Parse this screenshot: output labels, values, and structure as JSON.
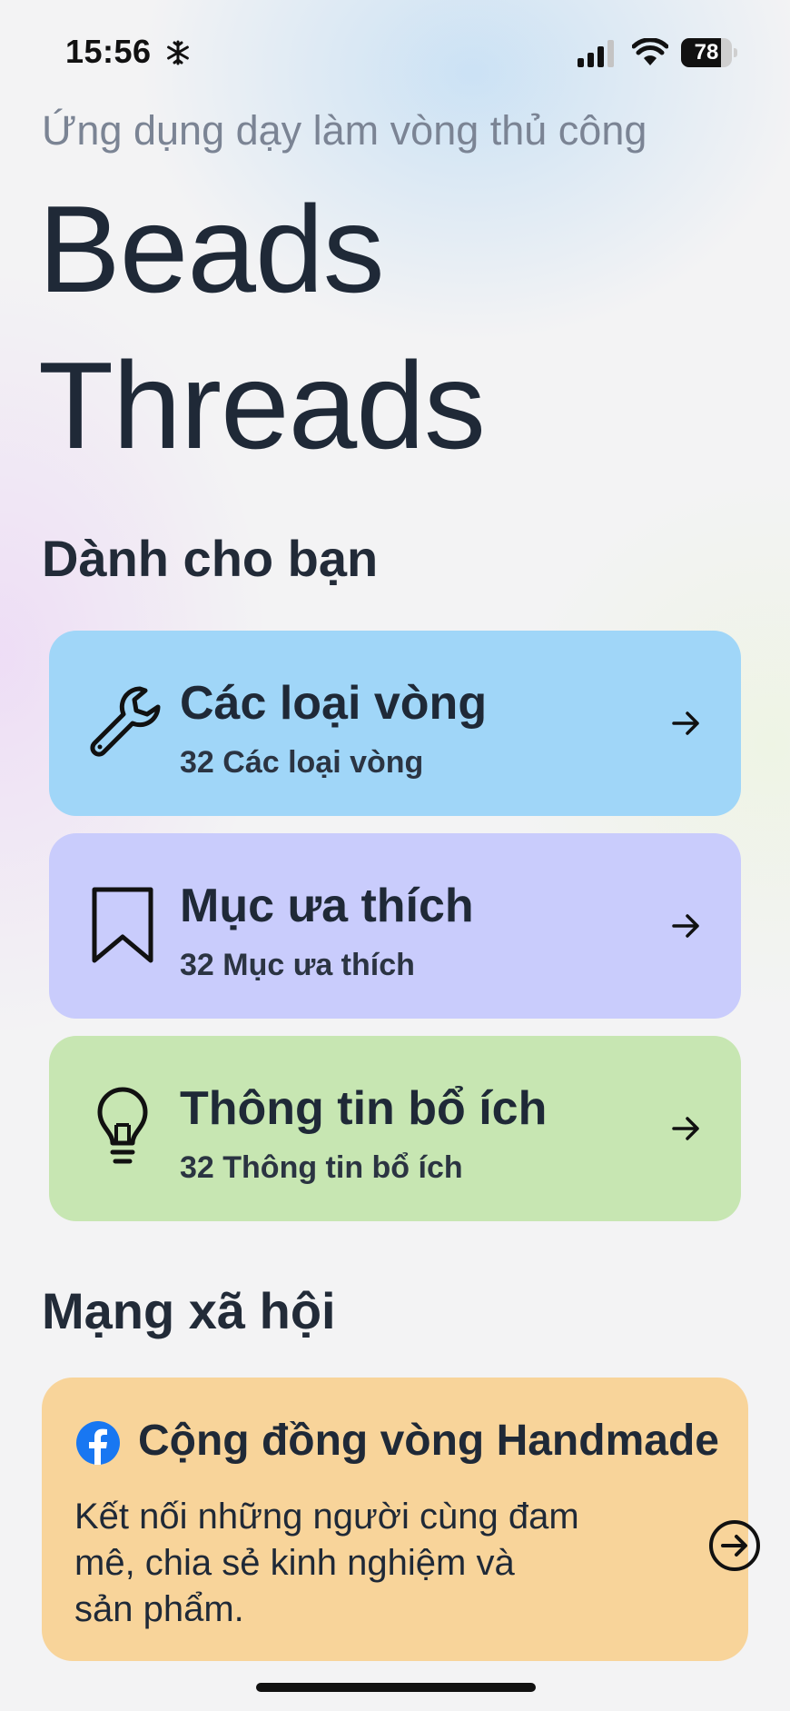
{
  "status_bar": {
    "time": "15:56",
    "battery": "78",
    "battery_level": 0.78,
    "icons": [
      "snowflake-icon",
      "cellular-signal-icon",
      "wifi-icon",
      "battery-icon"
    ]
  },
  "header": {
    "subtitle": "Ứng dụng dạy làm vòng thủ công",
    "title_line1": "Beads",
    "title_line2": "Threads"
  },
  "for_you": {
    "section_title": "Dành cho bạn",
    "cards": [
      {
        "title": "Các loại vòng",
        "subtitle": "32 Các loại vòng",
        "icon": "wrench-icon",
        "color": "#a0d6f8"
      },
      {
        "title": "Mục ưa thích",
        "subtitle": "32 Mục ưa thích",
        "icon": "bookmark-icon",
        "color": "#c9ccfc"
      },
      {
        "title": "Thông tin bổ ích",
        "subtitle": "32 Thông tin bổ ích",
        "icon": "lightbulb-icon",
        "color": "#c7e6b2"
      }
    ]
  },
  "social": {
    "section_title": "Mạng xã hội",
    "card": {
      "title": "Cộng đồng vòng Handmade",
      "description": "Kết nối những người cùng đam mê, chia sẻ kinh nghiệm và sản phẩm.",
      "icon": "facebook-icon",
      "color": "#f8d49a"
    }
  },
  "colors": {
    "facebook_blue": "#1877f2",
    "text_primary": "#1f2937",
    "text_muted": "#7b8494"
  }
}
